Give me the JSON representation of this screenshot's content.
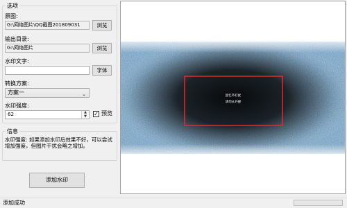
{
  "options": {
    "legend": "选项",
    "source_label": "原图:",
    "source_value": "G:\\网络图片\\QQ截图201809031",
    "browse1_label": "浏览",
    "output_label": "输出目录:",
    "output_value": "G:\\网络图片",
    "browse2_label": "浏览",
    "watermark_text_label": "水印文字:",
    "watermark_text_value": "",
    "font_button_label": "字体",
    "scheme_label": "转换方案:",
    "scheme_selected": "方案一",
    "strength_label": "水印强度:",
    "strength_value": "62",
    "preview_checkbox_label": "预览",
    "preview_checked": true
  },
  "info": {
    "legend": "信息",
    "text": "水印强度: 如果添加水印后效果不好，可以尝试增加强度，但图片干扰会略之增加。"
  },
  "add_watermark_button": "添加水印",
  "preview_image": {
    "watermark_line1": "回忆不打扰",
    "watermark_line2": "请勿从外部"
  },
  "status": {
    "text": "添加成功",
    "progress": 0
  },
  "colors": {
    "highlight_box": "#e8282c",
    "image_dark": "#05080a",
    "progress_bg": "#e6e6e6"
  },
  "icons": {
    "check": "✓",
    "chevron": "⌄"
  }
}
